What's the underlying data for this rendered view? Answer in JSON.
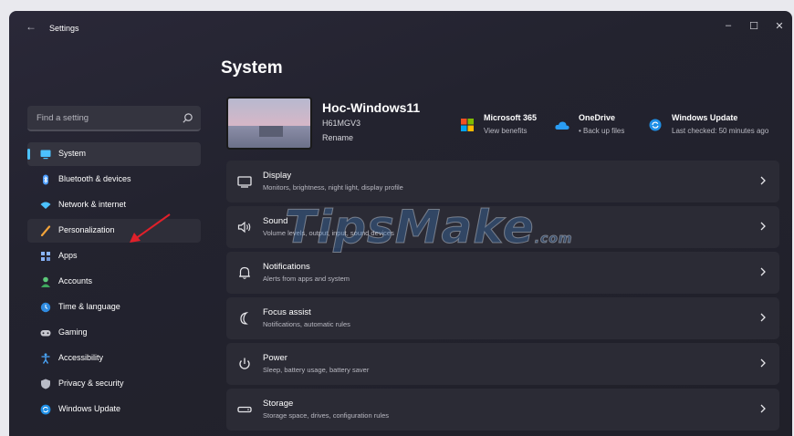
{
  "window": {
    "title": "Settings",
    "controls": {
      "minimize": "–",
      "maximize": "☐",
      "close": "✕"
    }
  },
  "page": {
    "title": "System"
  },
  "search": {
    "placeholder": "Find a setting"
  },
  "sidebar": {
    "items": [
      {
        "label": "System",
        "icon": "system-icon",
        "state": "selected"
      },
      {
        "label": "Bluetooth & devices",
        "icon": "bluetooth-icon"
      },
      {
        "label": "Network & internet",
        "icon": "network-icon"
      },
      {
        "label": "Personalization",
        "icon": "personalization-icon",
        "state": "hover"
      },
      {
        "label": "Apps",
        "icon": "apps-icon"
      },
      {
        "label": "Accounts",
        "icon": "accounts-icon"
      },
      {
        "label": "Time & language",
        "icon": "time-language-icon"
      },
      {
        "label": "Gaming",
        "icon": "gaming-icon"
      },
      {
        "label": "Accessibility",
        "icon": "accessibility-icon"
      },
      {
        "label": "Privacy & security",
        "icon": "privacy-icon"
      },
      {
        "label": "Windows Update",
        "icon": "windows-update-icon"
      }
    ]
  },
  "device": {
    "name": "Hoc-Windows11",
    "model": "H61MGV3",
    "rename": "Rename"
  },
  "quick_links": [
    {
      "title": "Microsoft 365",
      "subtitle": "View benefits",
      "icon": "microsoft-365-icon"
    },
    {
      "title": "OneDrive",
      "subtitle": "• Back up files",
      "icon": "onedrive-icon"
    },
    {
      "title": "Windows Update",
      "subtitle": "Last checked: 50 minutes ago",
      "icon": "windows-update-icon"
    }
  ],
  "cards": [
    {
      "title": "Display",
      "subtitle": "Monitors, brightness, night light, display profile",
      "icon": "monitor-icon"
    },
    {
      "title": "Sound",
      "subtitle": "Volume levels, output, input, sound devices",
      "icon": "speaker-icon"
    },
    {
      "title": "Notifications",
      "subtitle": "Alerts from apps and system",
      "icon": "bell-icon"
    },
    {
      "title": "Focus assist",
      "subtitle": "Notifications, automatic rules",
      "icon": "moon-icon"
    },
    {
      "title": "Power",
      "subtitle": "Sleep, battery usage, battery saver",
      "icon": "power-icon"
    },
    {
      "title": "Storage",
      "subtitle": "Storage space, drives, configuration rules",
      "icon": "storage-icon"
    }
  ],
  "watermark": {
    "text": "TipsMake",
    "suffix": ".com"
  },
  "colors": {
    "accent": "#4cc2ff",
    "background": "#202029",
    "card": "#2b2b35",
    "annotation_arrow": "#e0202a"
  }
}
